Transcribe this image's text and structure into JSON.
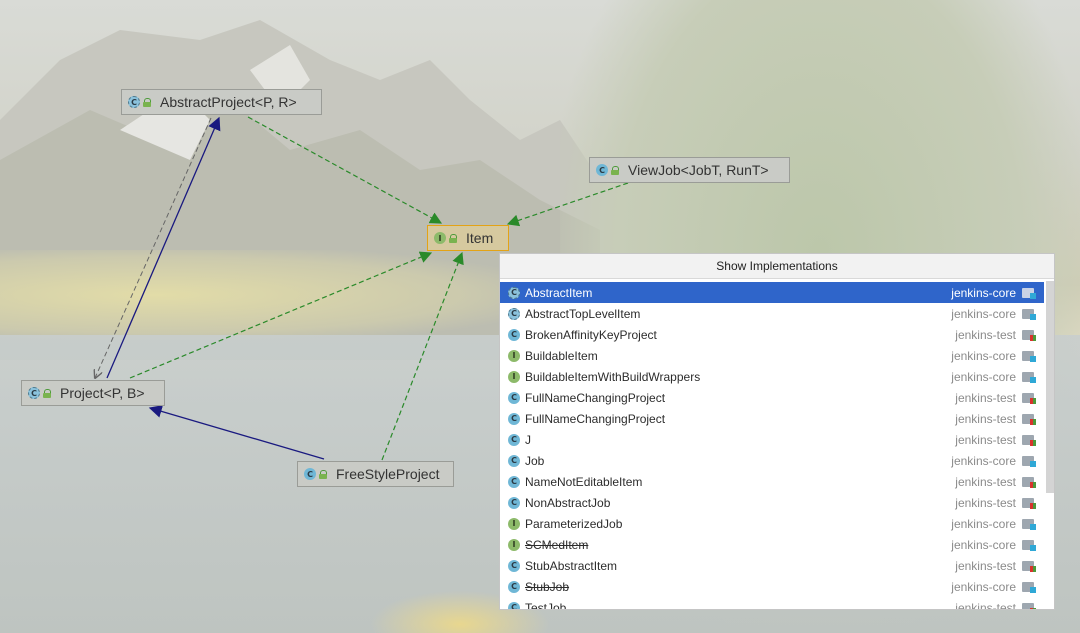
{
  "diagram": {
    "nodes": [
      {
        "id": "abstract-project",
        "label": "AbstractProject<P, R>",
        "kind": "abstract-class"
      },
      {
        "id": "view-job",
        "label": "ViewJob<JobT, RunT>",
        "kind": "class"
      },
      {
        "id": "item",
        "label": "Item",
        "kind": "interface",
        "selected": true
      },
      {
        "id": "project",
        "label": "Project<P, B>",
        "kind": "abstract-class"
      },
      {
        "id": "freestyle-project",
        "label": "FreeStyleProject",
        "kind": "class"
      }
    ]
  },
  "popup": {
    "title": "Show Implementations",
    "items": [
      {
        "name": "AbstractItem",
        "module": "jenkins-core",
        "kind": "abstract-class",
        "selected": true
      },
      {
        "name": "AbstractTopLevelItem",
        "module": "jenkins-core",
        "kind": "abstract-class"
      },
      {
        "name": "BrokenAffinityKeyProject",
        "module": "jenkins-test",
        "kind": "class"
      },
      {
        "name": "BuildableItem",
        "module": "jenkins-core",
        "kind": "interface"
      },
      {
        "name": "BuildableItemWithBuildWrappers",
        "module": "jenkins-core",
        "kind": "interface"
      },
      {
        "name": "FullNameChangingProject",
        "module": "jenkins-test",
        "kind": "class"
      },
      {
        "name": "FullNameChangingProject",
        "module": "jenkins-test",
        "kind": "class"
      },
      {
        "name": "J",
        "module": "jenkins-test",
        "kind": "class"
      },
      {
        "name": "Job",
        "module": "jenkins-core",
        "kind": "class"
      },
      {
        "name": "NameNotEditableItem",
        "module": "jenkins-test",
        "kind": "class"
      },
      {
        "name": "NonAbstractJob",
        "module": "jenkins-test",
        "kind": "class"
      },
      {
        "name": "ParameterizedJob",
        "module": "jenkins-core",
        "kind": "interface"
      },
      {
        "name": "SCMedItem",
        "module": "jenkins-core",
        "kind": "interface",
        "deprecated": true
      },
      {
        "name": "StubAbstractItem",
        "module": "jenkins-test",
        "kind": "class"
      },
      {
        "name": "StubJob",
        "module": "jenkins-core",
        "kind": "class",
        "deprecated": true
      },
      {
        "name": "TestJob",
        "module": "jenkins-test",
        "kind": "class"
      }
    ]
  },
  "colors": {
    "selection": "#2f65ca",
    "realization_edge": "#2a8a2a",
    "inheritance_edge": "#1a1a80",
    "selected_node_border": "#e3a316"
  }
}
